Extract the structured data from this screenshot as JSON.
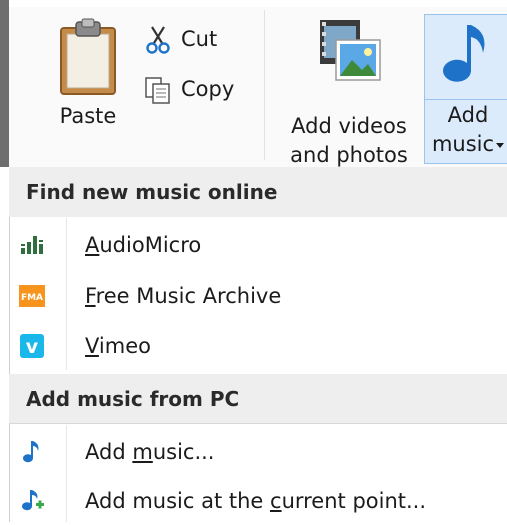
{
  "ribbon": {
    "paste_label": "Paste",
    "cut_label": "Cut",
    "copy_label": "Copy",
    "add_videos_line1": "Add videos",
    "add_videos_line2": "and photos",
    "add_music_line1": "Add",
    "add_music_line2": "music"
  },
  "menu": {
    "section_online": "Find new music online",
    "online_items": [
      {
        "icon": "audiomicro-icon",
        "label_accel": "A",
        "label_rest": "udioMicro"
      },
      {
        "icon": "fma-icon",
        "icon_text": "FMA",
        "label_accel": "F",
        "label_rest": "ree Music Archive"
      },
      {
        "icon": "vimeo-icon",
        "icon_text": "v",
        "label_accel": "V",
        "label_rest": "imeo"
      }
    ],
    "section_pc": "Add music from PC",
    "pc_items": [
      {
        "icon": "music-note-icon",
        "label_pre": "Add ",
        "label_accel": "m",
        "label_rest": "usic..."
      },
      {
        "icon": "add-music-current-icon",
        "label_pre": "Add music at the ",
        "label_accel": "c",
        "label_rest": "urrent point..."
      }
    ]
  },
  "colors": {
    "accent_blue": "#1e73c8",
    "selected_bg": "#dcebfb",
    "fma_orange": "#f7941d",
    "vimeo_blue": "#1ab7ea",
    "audiomicro_green": "#2f6f3f"
  }
}
